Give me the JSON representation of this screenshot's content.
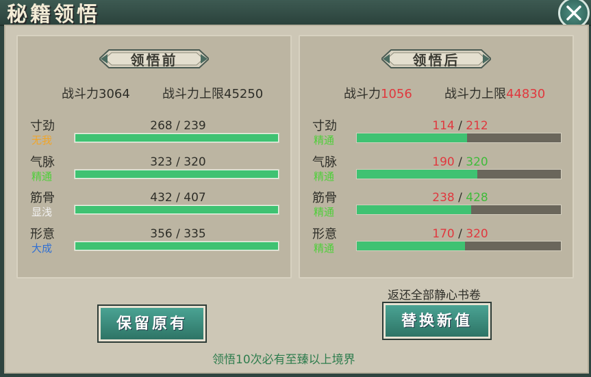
{
  "window": {
    "title": "秘籍领悟",
    "close_label": "X"
  },
  "before": {
    "banner": "领悟前",
    "power_label": "战斗力",
    "power_value": "3064",
    "limit_label": "战斗力上限",
    "limit_value": "45250",
    "stats": [
      {
        "name": "寸劲",
        "level": "无我",
        "current": "268",
        "max": "239",
        "fill": 1.0
      },
      {
        "name": "气脉",
        "level": "精通",
        "current": "323",
        "max": "320",
        "fill": 1.0
      },
      {
        "name": "筋骨",
        "level": "显浅",
        "current": "432",
        "max": "407",
        "fill": 1.0
      },
      {
        "name": "形意",
        "level": "大成",
        "current": "356",
        "max": "335",
        "fill": 1.0
      }
    ]
  },
  "after": {
    "banner": "领悟后",
    "power_label": "战斗力",
    "power_value": "1056",
    "limit_label": "战斗力上限",
    "limit_value": "44830",
    "stats": [
      {
        "name": "寸劲",
        "level": "精通",
        "current": "114",
        "max": "212",
        "fill": 0.54
      },
      {
        "name": "气脉",
        "level": "精通",
        "current": "190",
        "max": "320",
        "fill": 0.59
      },
      {
        "name": "筋骨",
        "level": "精通",
        "current": "238",
        "max": "428",
        "fill": 0.56
      },
      {
        "name": "形意",
        "level": "精通",
        "current": "170",
        "max": "320",
        "fill": 0.53
      }
    ]
  },
  "actions": {
    "keep_label": "保留原有",
    "replace_label": "替换新值",
    "refund_note": "返还全部静心书卷",
    "footer_note": "领悟10次必有至臻以上境界"
  },
  "colors": {
    "decrease": "#e0383e",
    "increase": "#3fbb3a",
    "bar_fill": "#3fc272",
    "button": "#3a8c7d"
  }
}
